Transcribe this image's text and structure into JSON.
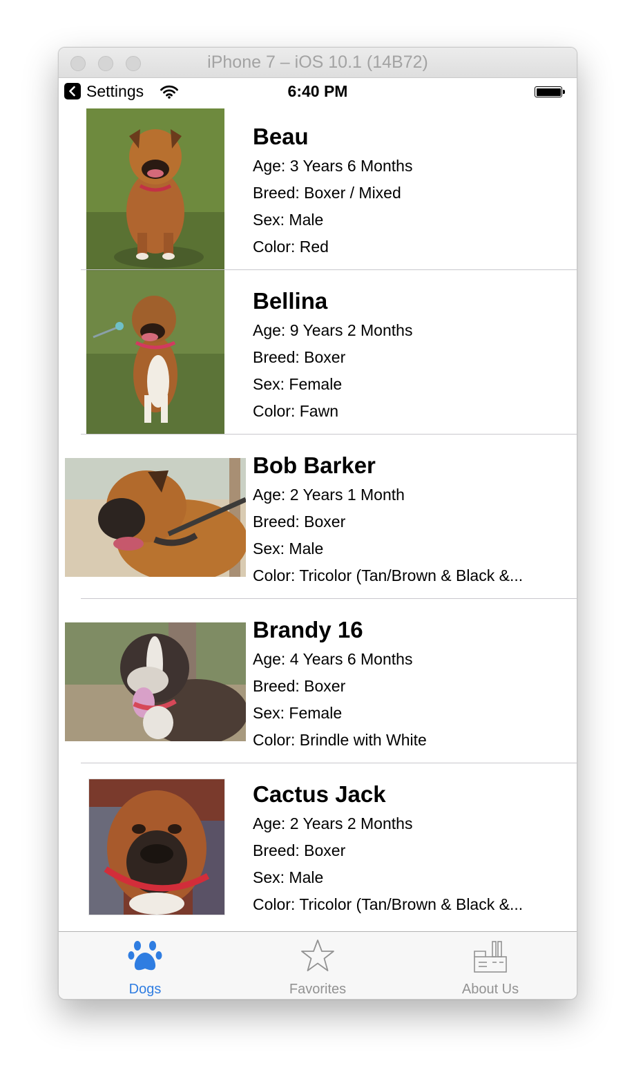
{
  "window": {
    "title": "iPhone 7 – iOS 10.1 (14B72)"
  },
  "status_bar": {
    "back_label": "Settings",
    "time": "6:40 PM",
    "battery_level": 1.0
  },
  "dogs": [
    {
      "name": "Beau",
      "age": "Age: 3 Years 6 Months",
      "breed": "Breed: Boxer / Mixed",
      "sex": "Sex: Male",
      "color": "Color: Red"
    },
    {
      "name": "Bellina",
      "age": "Age: 9 Years 2 Months",
      "breed": "Breed: Boxer",
      "sex": "Sex: Female",
      "color": "Color: Fawn"
    },
    {
      "name": "Bob Barker",
      "age": "Age: 2 Years 1 Month",
      "breed": "Breed: Boxer",
      "sex": "Sex: Male",
      "color": "Color: Tricolor (Tan/Brown & Black &..."
    },
    {
      "name": "Brandy 16",
      "age": "Age: 4 Years 6 Months",
      "breed": "Breed: Boxer",
      "sex": "Sex: Female",
      "color": "Color: Brindle with White"
    },
    {
      "name": "Cactus Jack",
      "age": "Age: 2 Years 2 Months",
      "breed": "Breed: Boxer",
      "sex": "Sex: Male",
      "color": "Color: Tricolor (Tan/Brown & Black &..."
    }
  ],
  "tab_bar": {
    "tabs": [
      {
        "label": "Dogs",
        "icon": "paw-icon",
        "selected": true
      },
      {
        "label": "Favorites",
        "icon": "star-icon",
        "selected": false
      },
      {
        "label": "About Us",
        "icon": "building-icon",
        "selected": false
      }
    ]
  },
  "colors": {
    "tint": "#2f7de1",
    "tab_inactive": "#929292"
  }
}
